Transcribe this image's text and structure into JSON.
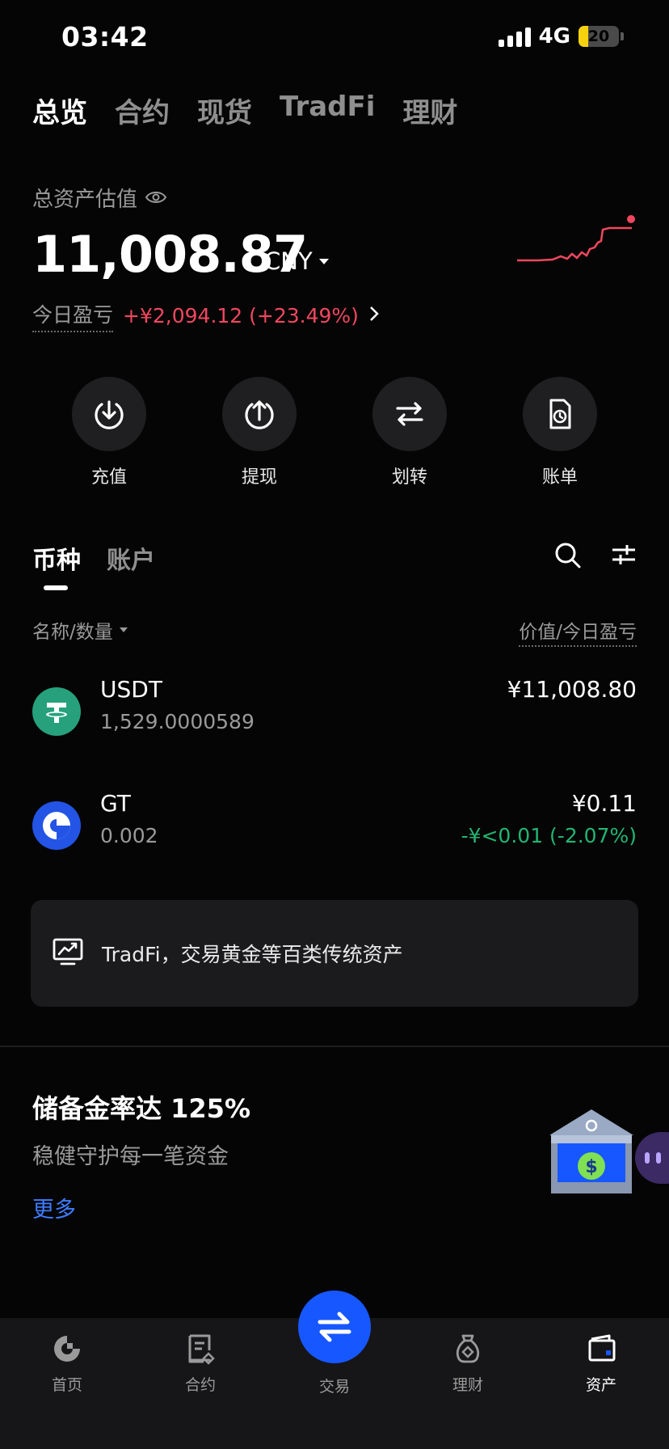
{
  "status_bar": {
    "time": "03:42",
    "network": "4G",
    "battery": "20"
  },
  "top_tabs": [
    {
      "label": "总览",
      "active": true
    },
    {
      "label": "合约",
      "active": false
    },
    {
      "label": "现货",
      "active": false
    },
    {
      "label": "TradFi",
      "active": false
    },
    {
      "label": "理财",
      "active": false
    }
  ],
  "assets": {
    "label": "总资产估值",
    "value": "11,008.87",
    "currency": "CNY",
    "pnl_label": "今日盈亏",
    "pnl_value": "+¥2,094.12 (+23.49%)"
  },
  "actions": [
    {
      "label": "充值",
      "icon": "deposit-icon"
    },
    {
      "label": "提现",
      "icon": "withdraw-icon"
    },
    {
      "label": "划转",
      "icon": "transfer-icon"
    },
    {
      "label": "账单",
      "icon": "bill-icon"
    }
  ],
  "coin_tabs": [
    {
      "label": "币种",
      "active": true
    },
    {
      "label": "账户",
      "active": false
    }
  ],
  "list_header": {
    "left": "名称/数量",
    "right": "价值/今日盈亏"
  },
  "coins": [
    {
      "name": "USDT",
      "qty": "1,529.0000589",
      "value": "¥11,008.80",
      "pnl": "",
      "icon": "usdt-icon"
    },
    {
      "name": "GT",
      "qty": "0.002",
      "value": "¥0.11",
      "pnl": "-¥<0.01 (-2.07%)",
      "icon": "gt-icon"
    }
  ],
  "tradfi_banner": {
    "text": "TradFi，交易黄金等百类传统资产"
  },
  "reserve": {
    "title": "储备金率达 125%",
    "subtitle": "稳健守护每一笔资金",
    "more": "更多"
  },
  "bottom_nav": [
    {
      "label": "首页",
      "active": false
    },
    {
      "label": "合约",
      "active": false
    },
    {
      "label": "交易",
      "active": false
    },
    {
      "label": "理财",
      "active": false
    },
    {
      "label": "资产",
      "active": true
    }
  ],
  "colors": {
    "positive": "#f0475f",
    "negative": "#22b573",
    "accent": "#1757ff",
    "link": "#3d7dff"
  }
}
